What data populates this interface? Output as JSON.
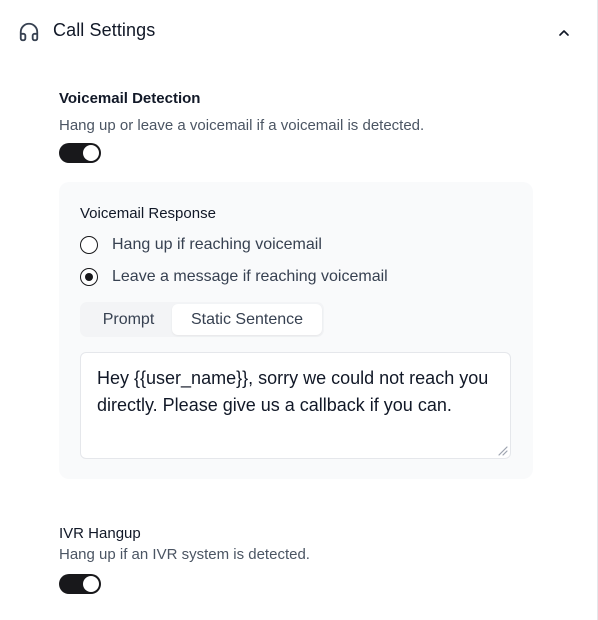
{
  "header": {
    "title": "Call Settings",
    "icon": "headphones-icon",
    "toggle_icon": "chevron-up-icon"
  },
  "voicemail_detection": {
    "title": "Voicemail Detection",
    "description": "Hang up or leave a voicemail if a voicemail is detected.",
    "enabled": true
  },
  "voicemail_response": {
    "title": "Voicemail Response",
    "options": [
      {
        "label": "Hang up if reaching voicemail",
        "selected": false
      },
      {
        "label": "Leave a message if reaching voicemail",
        "selected": true
      }
    ],
    "tabs": [
      {
        "label": "Prompt",
        "active": false
      },
      {
        "label": "Static Sentence",
        "active": true
      }
    ],
    "message": "Hey {{user_name}}, sorry we could not reach you directly. Please give us a callback if you can."
  },
  "ivr_hangup": {
    "title": "IVR Hangup",
    "description": "Hang up if an IVR system is detected.",
    "enabled": true
  },
  "colors": {
    "toggle_on": "#18181b",
    "card_bg": "#f9fafb",
    "text_primary": "#111827",
    "text_secondary": "#4b5563"
  }
}
